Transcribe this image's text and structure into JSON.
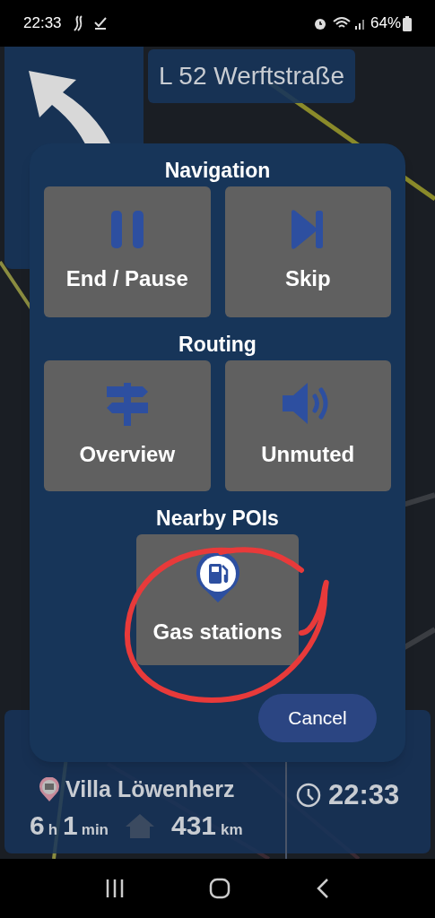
{
  "status_bar": {
    "time": "22:33",
    "battery": "64%"
  },
  "maneuver": {
    "street": "L 52 Werftstraße"
  },
  "dialog": {
    "sections": [
      {
        "title": "Navigation",
        "buttons": [
          {
            "label": "End / Pause",
            "kind": "pause"
          },
          {
            "label": "Skip",
            "kind": "skip"
          }
        ]
      },
      {
        "title": "Routing",
        "buttons": [
          {
            "label": "Overview",
            "kind": "signpost"
          },
          {
            "label": "Unmuted",
            "kind": "speaker"
          }
        ]
      },
      {
        "title": "Nearby POIs",
        "buttons": [
          {
            "label": "Gas stations",
            "kind": "fuel"
          }
        ]
      }
    ],
    "cancel": "Cancel"
  },
  "trip": {
    "destination": "Villa Löwenherz",
    "hours": "6",
    "hours_unit": "h",
    "minutes": "1",
    "minutes_unit": "min",
    "distance": "431",
    "distance_unit": "km",
    "arrival": "22:33"
  }
}
